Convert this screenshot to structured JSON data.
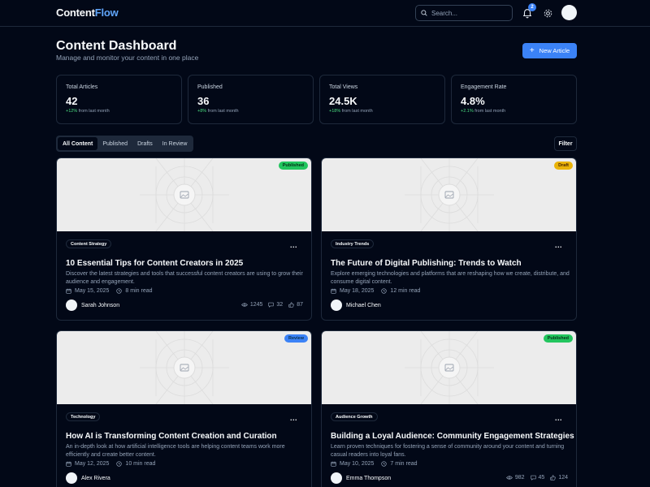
{
  "header": {
    "logo_main": "Content",
    "logo_accent": "Flow",
    "search_placeholder": "Search...",
    "notification_count": "2"
  },
  "page": {
    "title": "Content Dashboard",
    "subtitle": "Manage and monitor your content in one place",
    "new_button": "New Article"
  },
  "stats": [
    {
      "label": "Total Articles",
      "value": "42",
      "change": "+12%",
      "suffix": "from last month"
    },
    {
      "label": "Published",
      "value": "36",
      "change": "+8%",
      "suffix": "from last month"
    },
    {
      "label": "Total Views",
      "value": "24.5K",
      "change": "+18%",
      "suffix": "from last month"
    },
    {
      "label": "Engagement Rate",
      "value": "4.8%",
      "change": "+2.1%",
      "suffix": "from last month"
    }
  ],
  "tabs": [
    "All Content",
    "Published",
    "Drafts",
    "In Review"
  ],
  "filter_label": "Filter",
  "colors": {
    "accent": "#3b82f6",
    "published": "#22c55e",
    "draft": "#eab308",
    "review": "#3b82f6"
  },
  "cards": [
    {
      "status": "Published",
      "category": "Content Strategy",
      "title": "10 Essential Tips for Content Creators in 2025",
      "description": "Discover the latest strategies and tools that successful content creators are using to grow their audience and engagement.",
      "date": "May 15, 2025",
      "read_time": "8 min read",
      "author": "Sarah Johnson",
      "views": "1245",
      "comments": "32",
      "likes": "87"
    },
    {
      "status": "Draft",
      "category": "Industry Trends",
      "title": "The Future of Digital Publishing: Trends to Watch",
      "description": "Explore emerging technologies and platforms that are reshaping how we create, distribute, and consume digital content.",
      "date": "May 18, 2025",
      "read_time": "12 min read",
      "author": "Michael Chen"
    },
    {
      "status": "Review",
      "category": "Technology",
      "title": "How AI is Transforming Content Creation and Curation",
      "description": "An in-depth look at how artificial intelligence tools are helping content teams work more efficiently and create better content.",
      "date": "May 12, 2025",
      "read_time": "10 min read",
      "author": "Alex Rivera"
    },
    {
      "status": "Published",
      "category": "Audience Growth",
      "title": "Building a Loyal Audience: Community Engagement Strategies",
      "description": "Learn proven techniques for fostering a sense of community around your content and turning casual readers into loyal fans.",
      "date": "May 10, 2025",
      "read_time": "7 min read",
      "author": "Emma Thompson",
      "views": "982",
      "comments": "45",
      "likes": "124"
    }
  ]
}
